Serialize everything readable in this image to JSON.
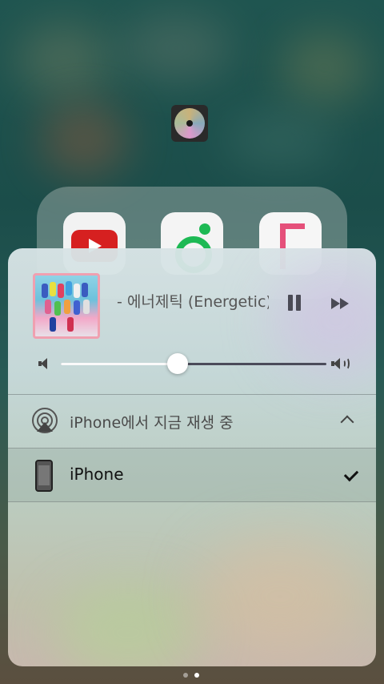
{
  "now_playing": {
    "title": "- 에너제틱 (Energetic)",
    "state": "playing",
    "volume": 0.44,
    "pause_label": "Pause",
    "next_label": "Next track"
  },
  "airplay": {
    "label": "iPhone에서 지금 재생 중",
    "icon": "airplay-icon",
    "expanded": true
  },
  "devices": [
    {
      "name": "iPhone",
      "icon": "iphone-icon",
      "selected": true
    }
  ],
  "page_indicator": {
    "count": 2,
    "current": 2
  },
  "colors": {
    "accent": "#4a4a55",
    "wallpaper": "#1f5550",
    "youtube_red": "#d62020",
    "melon_green": "#1db954"
  }
}
